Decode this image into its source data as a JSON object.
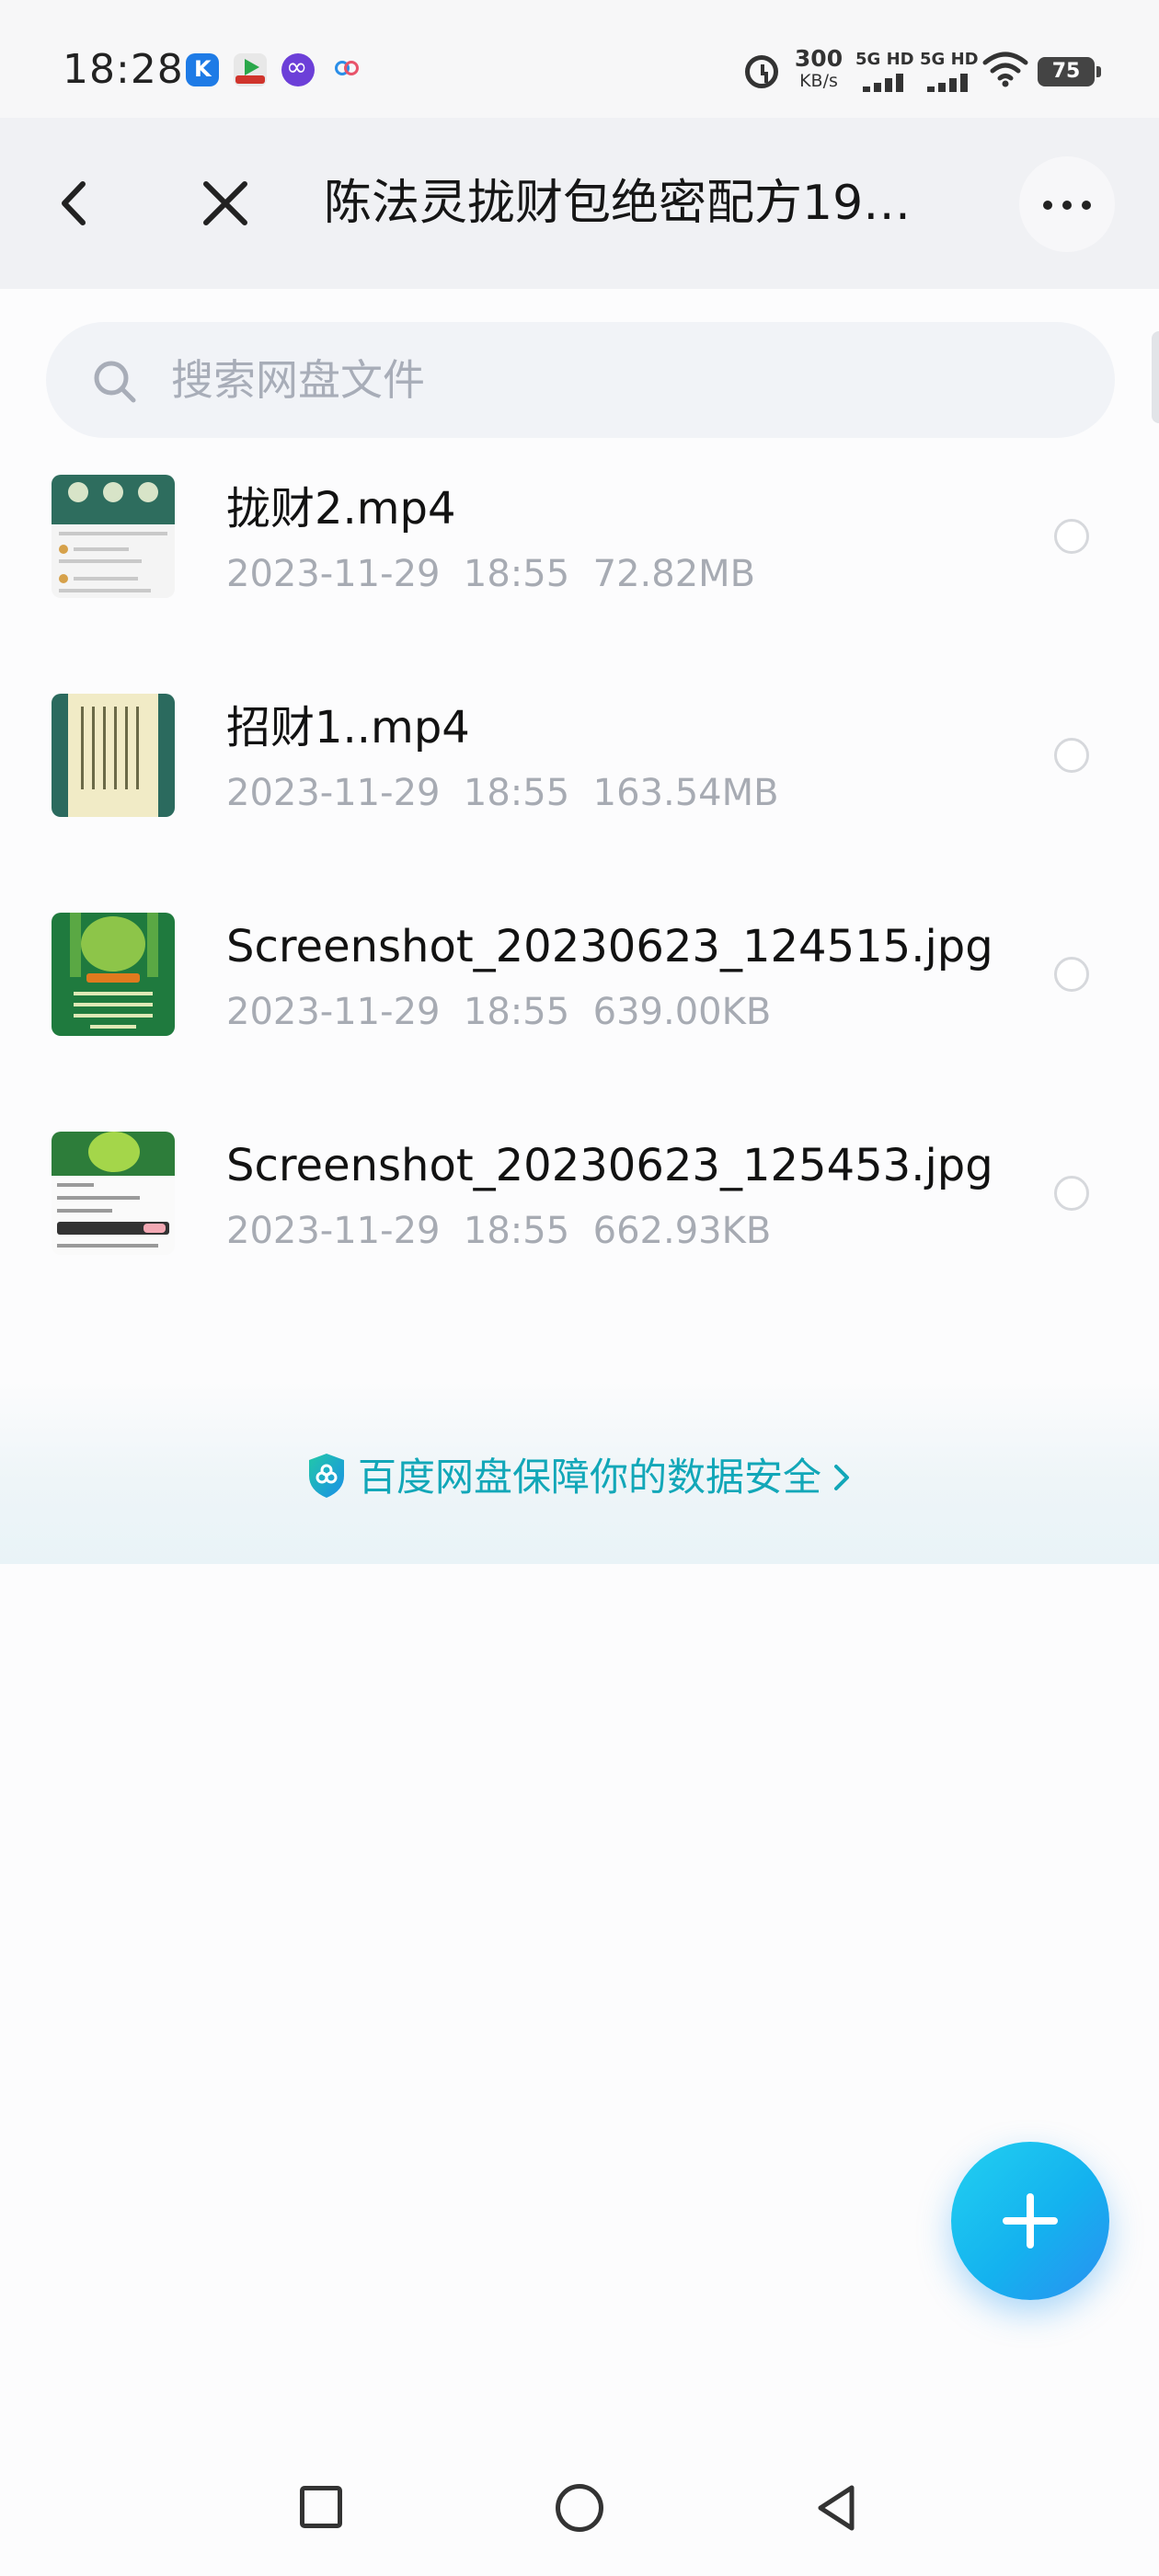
{
  "status_bar": {
    "time": "18:28",
    "net_speed_value": "300",
    "net_speed_unit": "KB/s",
    "sim1_label": "5G HD",
    "sim2_label": "5G HD",
    "battery": "75",
    "notification_icons": [
      "kuaiying-app-icon",
      "video-app-icon",
      "infinity-app-icon",
      "cloud-app-icon"
    ]
  },
  "header": {
    "title": "陈法灵拢财包绝密配方19…",
    "back_icon": "chevron-left-icon",
    "close_icon": "close-icon",
    "more_icon": "more-icon"
  },
  "search": {
    "placeholder": "搜索网盘文件",
    "value": ""
  },
  "files": [
    {
      "name": "拢财2.mp4",
      "date": "2023-11-29",
      "time": "18:55",
      "size": "72.82MB",
      "thumbnail": "video-thumbnail"
    },
    {
      "name": "招财1..mp4",
      "date": "2023-11-29",
      "time": "18:55",
      "size": "163.54MB",
      "thumbnail": "video-thumbnail"
    },
    {
      "name": "Screenshot_20230623_124515.jpg",
      "date": "2023-11-29",
      "time": "18:55",
      "size": "639.00KB",
      "thumbnail": "image-thumbnail"
    },
    {
      "name": "Screenshot_20230623_125453.jpg",
      "date": "2023-11-29",
      "time": "18:55",
      "size": "662.93KB",
      "thumbnail": "image-thumbnail"
    }
  ],
  "security_banner": {
    "text": "百度网盘保障你的数据安全",
    "icon": "shield-icon"
  },
  "fab": {
    "icon": "plus-icon"
  },
  "nav_bar": {
    "icons": [
      "recent-apps-icon",
      "home-icon",
      "back-icon"
    ]
  },
  "colors": {
    "accent": "#12a7b8",
    "fab": "#14b2ef",
    "header_bg": "#f0f1f4",
    "meta_text": "#a7abb3"
  }
}
